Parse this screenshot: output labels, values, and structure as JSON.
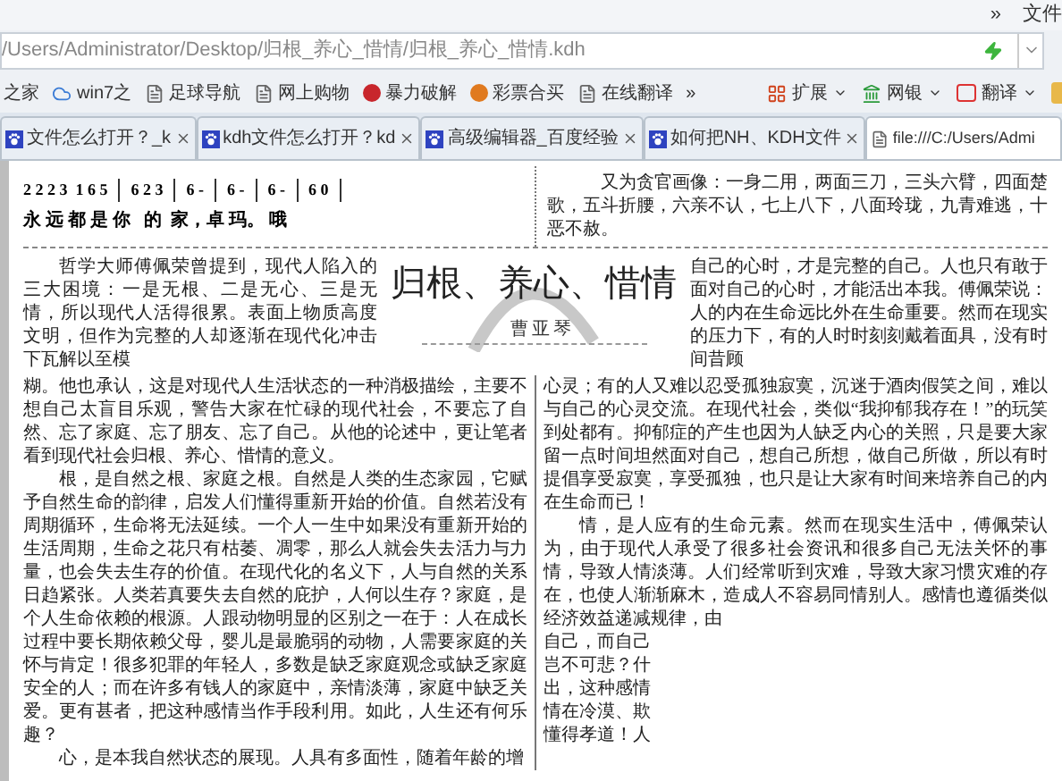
{
  "top_bar": {
    "overflow": "»",
    "menu": "文件"
  },
  "address_bar": {
    "url": "/Users/Administrator/Desktop/归根_养心_惜情/归根_养心_惜情.kdh"
  },
  "bookmarks": [
    {
      "kind": "site",
      "label": "之家"
    },
    {
      "kind": "cloud",
      "label": "win7之"
    },
    {
      "kind": "page",
      "label": "足球导航"
    },
    {
      "kind": "page",
      "label": "网上购物"
    },
    {
      "kind": "red",
      "label": "暴力破解"
    },
    {
      "kind": "orange",
      "label": "彩票合买"
    },
    {
      "kind": "page",
      "label": "在线翻译"
    }
  ],
  "bookmarks_overflow": "»",
  "toolbar": [
    {
      "kind": "grid",
      "label": "扩展"
    },
    {
      "kind": "bank",
      "label": "网银"
    },
    {
      "kind": "translate",
      "label": "翻译"
    }
  ],
  "tabs": [
    {
      "kind": "paw",
      "label": "文件怎么打开？_k",
      "selected": false
    },
    {
      "kind": "paw",
      "label": "kdh文件怎么打开？kd",
      "selected": false
    },
    {
      "kind": "paw",
      "label": "高级编辑器_百度经验",
      "selected": false
    },
    {
      "kind": "paw",
      "label": "如何把NH、KDH文件",
      "selected": false
    },
    {
      "kind": "file",
      "label": "file:///C:/Users/Admi",
      "selected": true
    }
  ],
  "document": {
    "notation": {
      "measures": [
        "2 2 2 3  1 6 5",
        "6 2 3",
        "6 -",
        "6 -",
        "6 -",
        "6 0"
      ],
      "lyrics": "永 远 都 是 你   的  家，卓 玛。 哦"
    },
    "box_text": "又为贪官画像：一身二用，两面三刀，三头六臂，四面楚歌，五斗折腰，六亲不认，七上八下，八面玲珑，九青难逃，十恶不赦。",
    "title": "归根、养心、惜情",
    "author": "曹亚琴",
    "left_intro": "哲学大师傅佩荣曾提到，现代人陷入的三大困境：一是无根、二是无心、三是无情，所以现代人活得很累。表面上物质高度文明，但作为完整的人却逐渐在现代化冲击下瓦解以至模",
    "left_paragraphs": [
      {
        "indent": false,
        "text": "糊。他也承认，这是对现代人生活状态的一种消极描绘，主要不想自己太盲目乐观，警告大家在忙碌的现代社会，不要忘了自然、忘了家庭、忘了朋友、忘了自己。从他的论述中，更让笔者看到现代社会归根、养心、惜情的意义。"
      },
      {
        "indent": true,
        "text": "根，是自然之根、家庭之根。自然是人类的生态家园，它赋予自然生命的韵律，启发人们懂得重新开始的价值。自然若没有周期循环，生命将无法延续。一个人一生中如果没有重新开始的生活周期，生命之花只有枯萎、凋零，那么人就会失去活力与力量，也会失去生存的价值。在现代化的名义下，人与自然的关系日趋紧张。人类若真要失去自然的庇护，人何以生存？家庭，是个人生命依赖的根源。人跟动物明显的区别之一在于：人在成长过程中要长期依赖父母，婴儿是最脆弱的动物，人需要家庭的关怀与肯定！很多犯罪的年轻人，多数是缺乏家庭观念或缺乏家庭安全的人；而在许多有钱人的家庭中，亲情淡薄，家庭中缺乏关爱。更有甚者，把这种感情当作手段利用。如此，人生还有何乐趣？"
      },
      {
        "indent": true,
        "text": "心，是本我自然状态的展现。人具有多面性，随着年龄的增"
      }
    ],
    "right_intro": "自己的心时，才是完整的自己。人也只有敢于面对自己的心时，才能活出本我。傅佩荣说：人的内在生命远比外在生命重要。然而在现实的压力下，有的人时时刻刻戴着面具，没有时间昔顾",
    "right_paragraphs": [
      {
        "indent": false,
        "text": "心灵；有的人又难以忍受孤独寂寞，沉迷于酒肉假笑之间，难以与自己的心灵交流。在现代社会，类似“我抑郁我存在！”的玩笑到处都有。抑郁症的产生也因为人缺乏内心的关照，只是要大家留一点时间坦然面对自己，想自己所想，做自己所做，所以有时提倡享受寂寞，享受孤独，也只是让大家有时间来培养自己的内在生命而已！"
      },
      {
        "indent": true,
        "text": "情，是人应有的生命元素。然而在现实生活中，傅佩荣认为，由于现代人承受了很多社会资讯和很多自己无法关怀的事情，导致人情淡薄。人们经常听到灾难，导致大家习惯灾难的存在，也使人渐渐麻木，造成人不容易同情别人。感情也遵循类似经济效益递减规律，由"
      }
    ],
    "right_fragments": [
      "自己，而自己",
      "岂不可悲？什",
      "出，这种感情",
      "情在冷漠、欺",
      "懂得孝道！人"
    ]
  }
}
